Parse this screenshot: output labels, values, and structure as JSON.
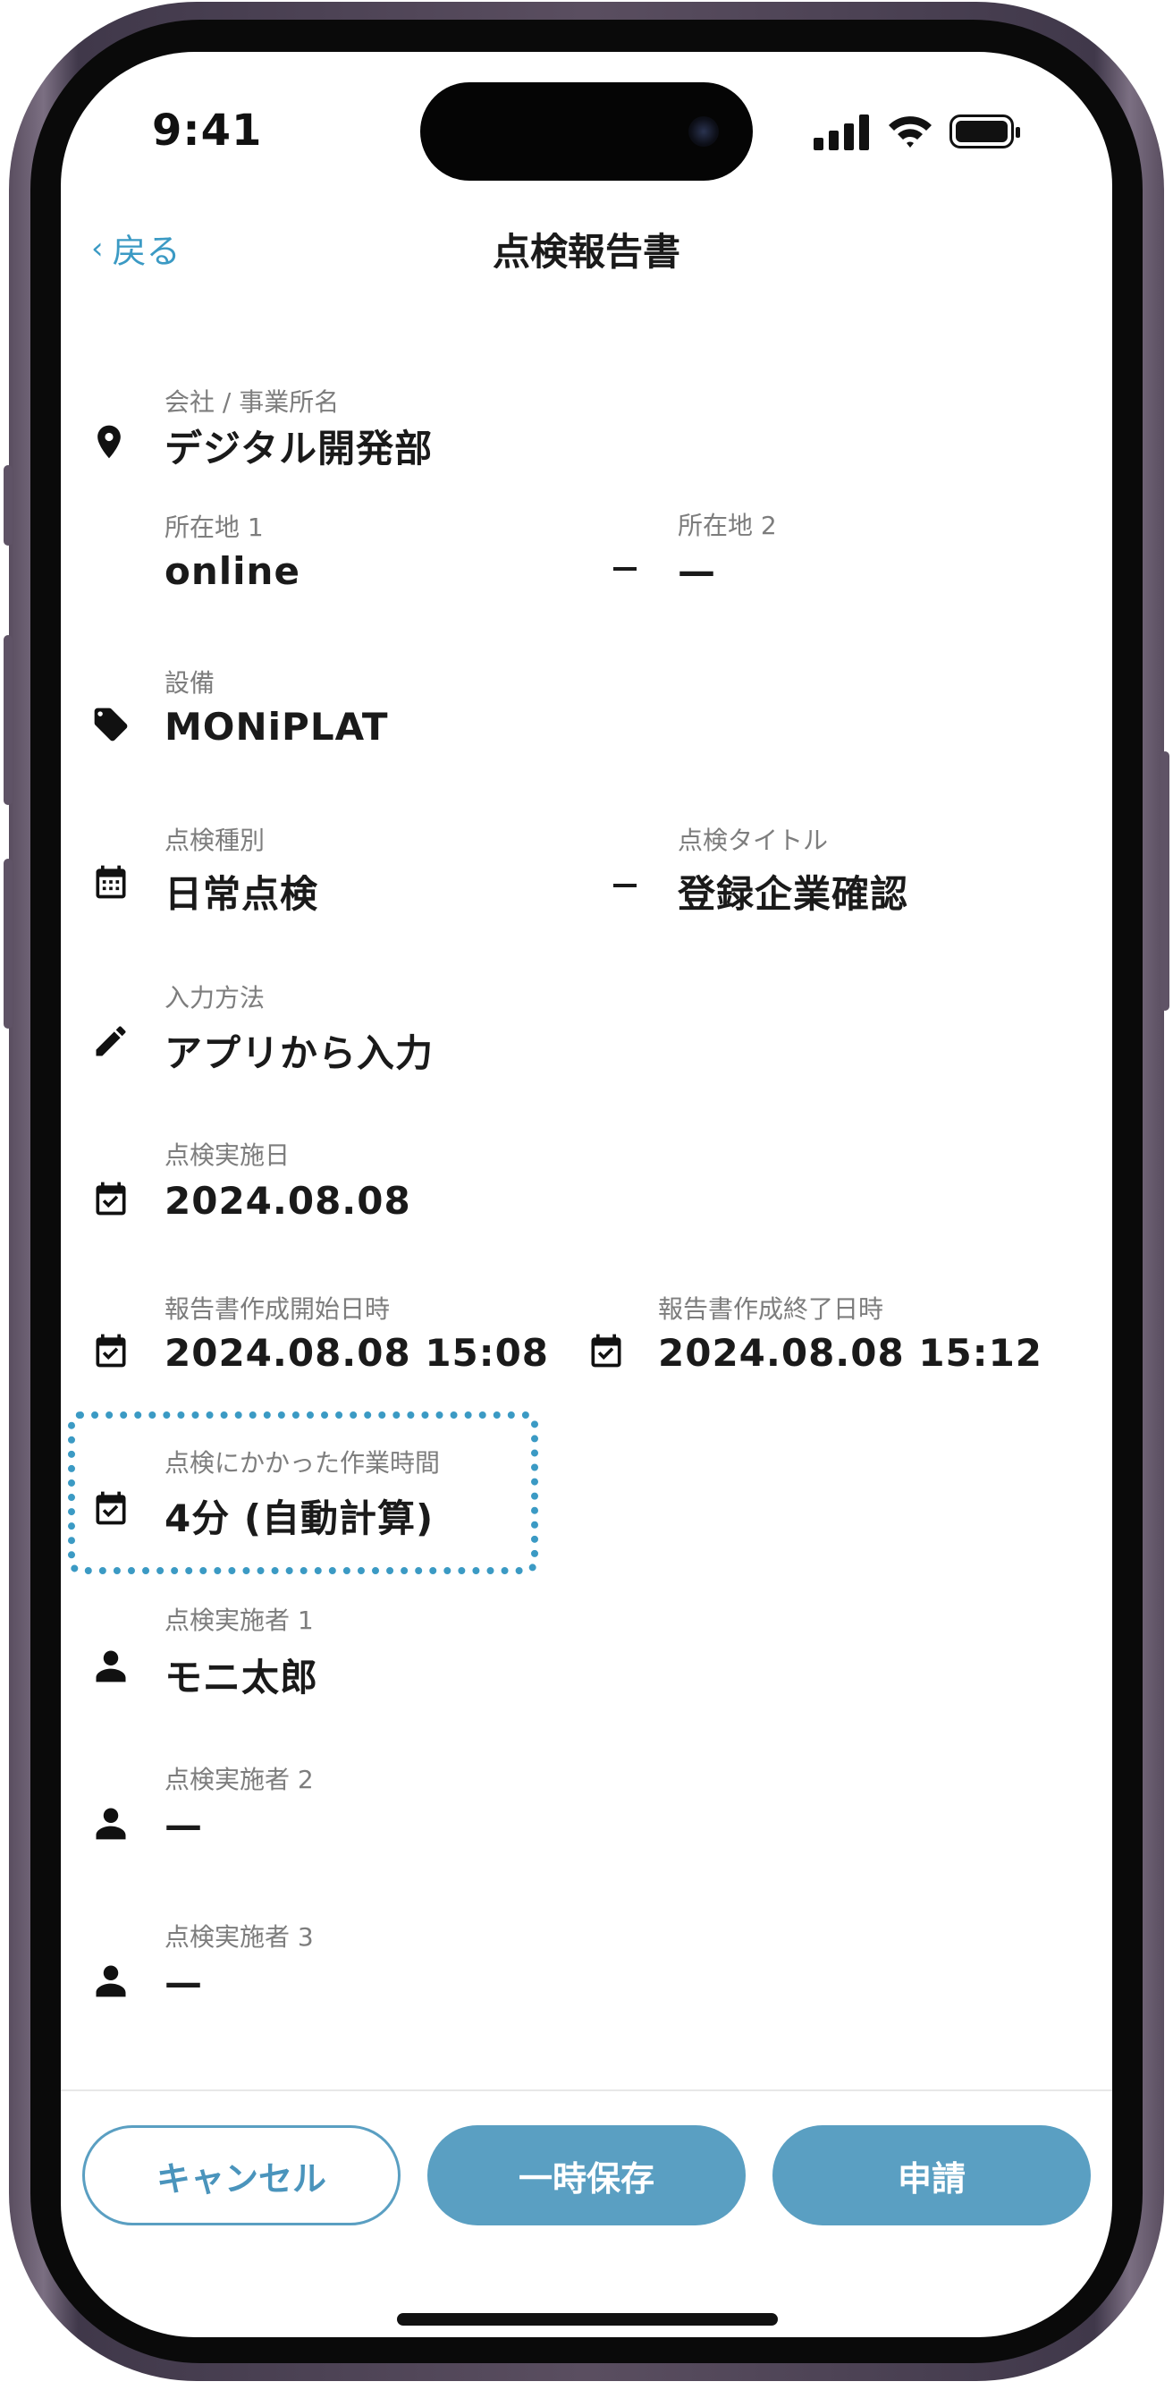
{
  "status_bar": {
    "time": "9:41"
  },
  "nav": {
    "back_label": "戻る",
    "title": "点検報告書"
  },
  "fields": {
    "company": {
      "label": "会社 / 事業所名",
      "value": "デジタル開発部"
    },
    "location1": {
      "label": "所在地 1",
      "value": "online"
    },
    "location2": {
      "label": "所在地 2",
      "value": "—"
    },
    "equipment": {
      "label": "設備",
      "value": "MONiPLAT"
    },
    "inspection_type": {
      "label": "点検種別",
      "value": "日常点検"
    },
    "inspection_title": {
      "label": "点検タイトル",
      "value": "登録企業確認"
    },
    "input_method": {
      "label": "入力方法",
      "value": "アプリから入力"
    },
    "inspection_date": {
      "label": "点検実施日",
      "value": "2024.08.08"
    },
    "report_start": {
      "label": "報告書作成開始日時",
      "value": "2024.08.08 15:08"
    },
    "report_end": {
      "label": "報告書作成終了日時",
      "value": "2024.08.08 15:12"
    },
    "work_time": {
      "label": "点検にかかった作業時間",
      "value": "4分 (自動計算)"
    },
    "inspector1": {
      "label": "点検実施者 1",
      "value": "モニ太郎"
    },
    "inspector2": {
      "label": "点検実施者 2",
      "value": "—"
    },
    "inspector3": {
      "label": "点検実施者 3",
      "value": "—"
    }
  },
  "buttons": {
    "cancel": "キャンセル",
    "save": "一時保存",
    "apply": "申請"
  },
  "colors": {
    "accent": "#3b9ac4",
    "button_fill": "#5a9fc2",
    "text": "#1a1a1a",
    "label": "#7d7d7d"
  },
  "icons": [
    "location-pin-icon",
    "tag-icon",
    "calendar-icon",
    "pencil-icon",
    "calendar-check-icon",
    "person-icon"
  ]
}
